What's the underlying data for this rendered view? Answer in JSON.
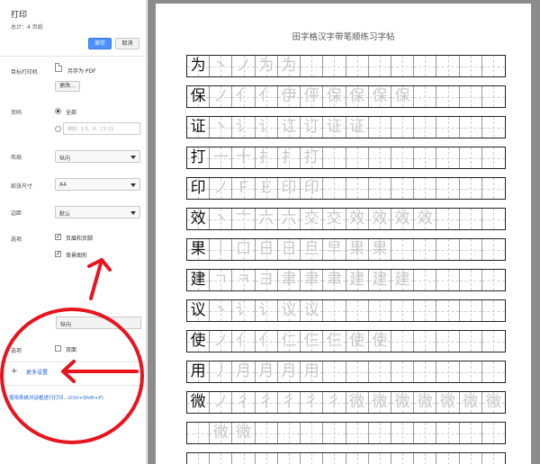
{
  "sidebar": {
    "title": "打印",
    "total": "总计：4 页纸",
    "save_label": "保存",
    "cancel_label": "取消",
    "destination_label": "目标打印机",
    "destination_value": "另存为 PDF",
    "change_label": "更改...",
    "pages_label": "页码",
    "pages_all": "全部",
    "pages_placeholder": "例如：1-5、8、11-13",
    "layout_label": "布局",
    "layout_value": "纵向",
    "paper_label": "纸张尺寸",
    "paper_value": "A4",
    "margins_label": "边距",
    "margins_value": "默认",
    "options_label": "选项",
    "opt_headers": "页眉和页脚",
    "opt_background": "背景图形",
    "layout2_value": "纵向",
    "options2_label": "选项",
    "duplex": "双面",
    "more_settings": "更多设置",
    "system_dialog": "使用系统对话框进行打印...(Ctrl+Shift+P)"
  },
  "annotations": {
    "color": "#e8141e"
  },
  "preview": {
    "title": "田字格汉字带笔顺练习字帖",
    "rows": [
      {
        "head": "为",
        "cells": [
          "丶",
          "ノ",
          "为",
          "为"
        ]
      },
      {
        "head": "保",
        "cells": [
          "ノ",
          "亻",
          "亻",
          "伊",
          "伻",
          "保",
          "保",
          "保",
          "保"
        ]
      },
      {
        "head": "证",
        "cells": [
          "丶",
          "讠",
          "讠",
          "讧",
          "订",
          "证",
          "证"
        ]
      },
      {
        "head": "打",
        "cells": [
          "一",
          "十",
          "扌",
          "扌",
          "打"
        ]
      },
      {
        "head": "印",
        "cells": [
          "ノ",
          "Ｆ",
          "E",
          "印",
          "印"
        ]
      },
      {
        "head": "效",
        "cells": [
          "丶",
          "亠",
          "六",
          "六",
          "交",
          "交",
          "效",
          "效",
          "效",
          "效"
        ]
      },
      {
        "head": "果",
        "cells": [
          "丨",
          "口",
          "日",
          "日",
          "旦",
          "早",
          "果",
          "果"
        ]
      },
      {
        "head": "建",
        "cells": [
          "ㄱ",
          "ㅋ",
          "ヨ",
          "聿",
          "聿",
          "聿",
          "建",
          "建",
          "建"
        ]
      },
      {
        "head": "议",
        "cells": [
          "丶",
          "讠",
          "讠",
          "议",
          "议"
        ]
      },
      {
        "head": "使",
        "cells": [
          "ノ",
          "亻",
          "亻",
          "仁",
          "仨",
          "仨",
          "使",
          "使"
        ]
      },
      {
        "head": "用",
        "cells": [
          "丿",
          "月",
          "月",
          "月",
          "用"
        ]
      },
      {
        "head": "微",
        "cells": [
          "ノ",
          "彳",
          "彳",
          "彳",
          "彳",
          "彳",
          "微",
          "微",
          "微",
          "微",
          "微",
          "微",
          "微"
        ]
      },
      {
        "head": "",
        "cells": [
          "微",
          "微"
        ]
      },
      {
        "head": "",
        "cells": []
      }
    ]
  }
}
